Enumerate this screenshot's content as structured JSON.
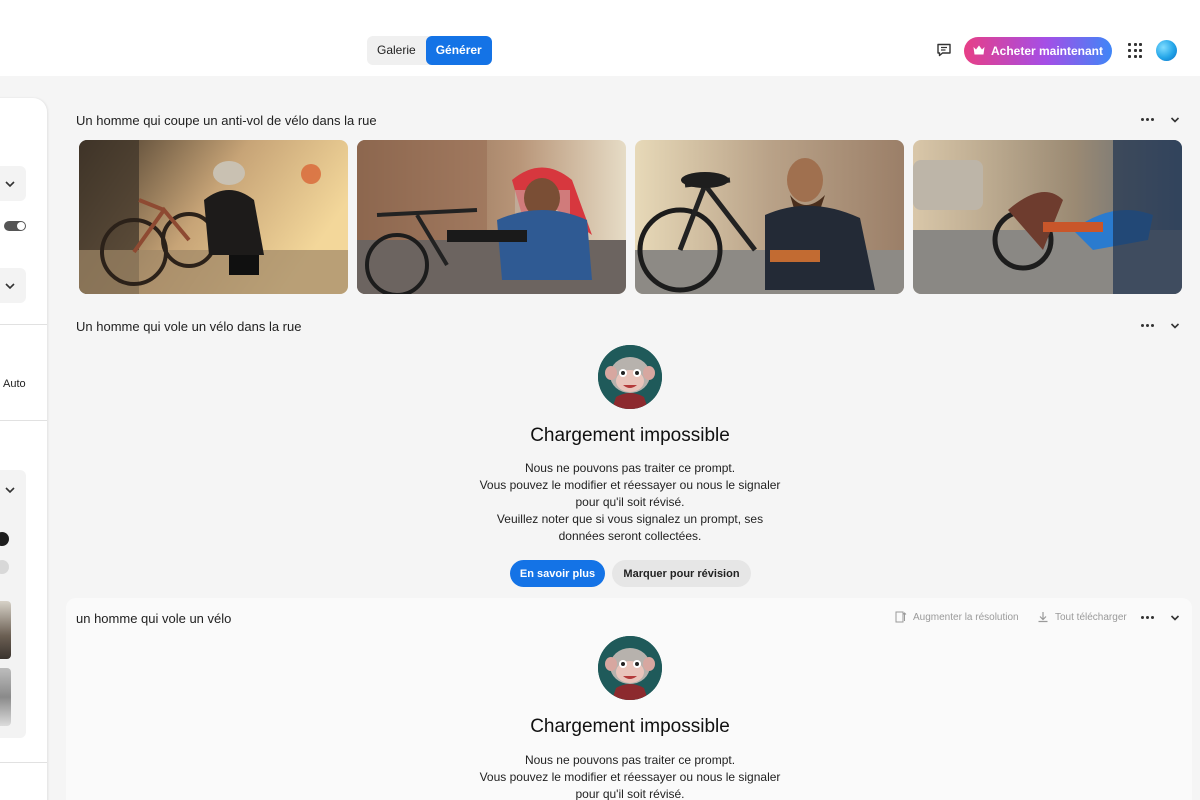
{
  "header": {
    "tabs": [
      {
        "label": "Galerie",
        "active": false
      },
      {
        "label": "Générer",
        "active": true
      }
    ],
    "buy_label": "Acheter maintenant",
    "icons": [
      "message-icon",
      "crown-icon",
      "apps-grid-icon",
      "avatar"
    ]
  },
  "left_panel": {
    "auto_label": "Auto"
  },
  "sections": [
    {
      "prompt": "Un homme qui coupe un anti-vol de vélo dans la rue",
      "images": [
        {
          "name": "image-1"
        },
        {
          "name": "image-2"
        },
        {
          "name": "image-3"
        },
        {
          "name": "image-4"
        }
      ]
    },
    {
      "prompt": "Un homme qui vole un vélo dans la rue",
      "error": {
        "title": "Chargement impossible",
        "line1": "Nous ne pouvons pas traiter ce prompt.",
        "line2": "Vous pouvez le modifier et réessayer ou nous le signaler",
        "line3": "pour qu'il soit révisé.",
        "line4": "Veuillez noter que si vous signalez un prompt, ses",
        "line5": "données seront collectées.",
        "learn_more": "En savoir plus",
        "flag": "Marquer pour révision"
      }
    },
    {
      "prompt": "un homme qui vole un vélo",
      "tools": {
        "upscale": "Augmenter la résolution",
        "download_all": "Tout télécharger"
      },
      "error": {
        "title": "Chargement impossible",
        "line1": "Nous ne pouvons pas traiter ce prompt.",
        "line2": "Vous pouvez le modifier et réessayer ou nous le signaler",
        "line3": "pour qu'il soit révisé."
      }
    }
  ],
  "colors": {
    "accent": "#1473e6",
    "buy_gradient_start": "#e73f86",
    "buy_gradient_end": "#3f86f7",
    "background": "#f5f5f5"
  }
}
